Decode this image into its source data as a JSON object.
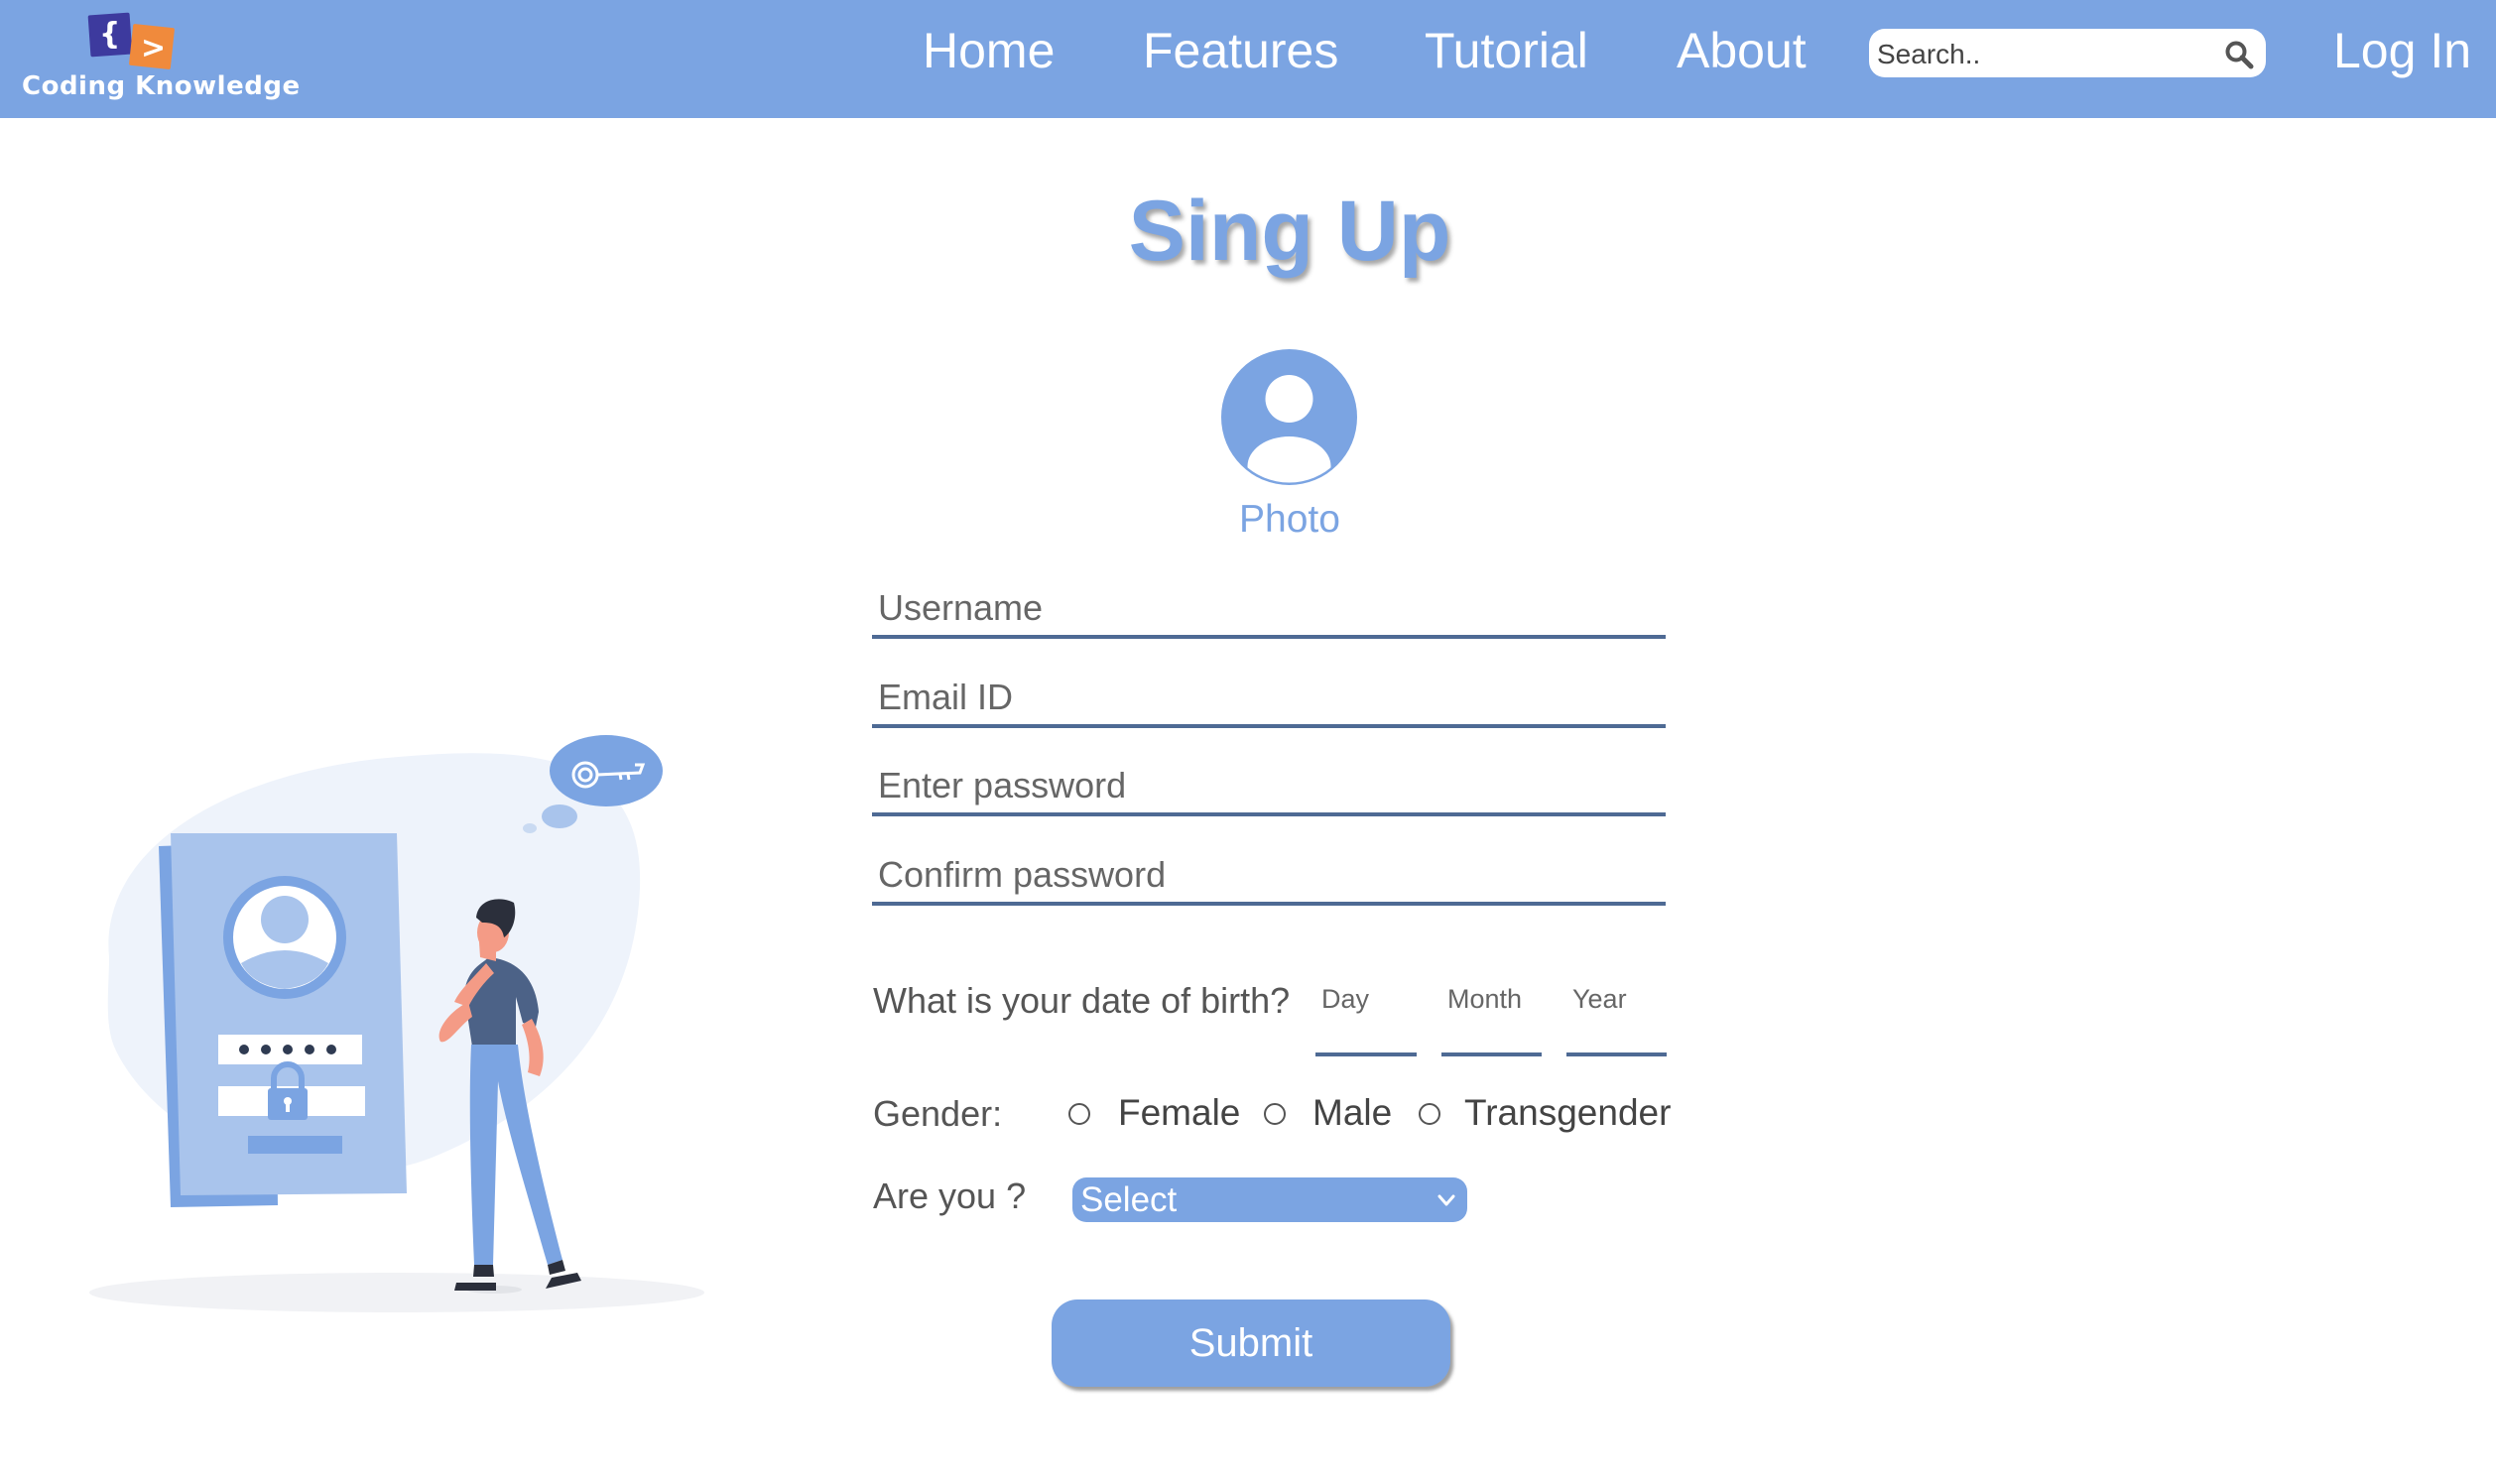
{
  "header": {
    "logo_text": "Coding Knowledge",
    "nav": [
      {
        "label": "Home"
      },
      {
        "label": "Features"
      },
      {
        "label": "Tutorial"
      },
      {
        "label": "About"
      }
    ],
    "search": {
      "placeholder": "Search..",
      "value": ""
    },
    "login_label": "Log In"
  },
  "page": {
    "title": "Sing Up",
    "photo_label": "Photo"
  },
  "form": {
    "username_placeholder": "Username",
    "email_placeholder": "Email ID",
    "password_placeholder": "Enter password",
    "confirm_placeholder": "Confirm password",
    "dob_question": "What is your date of birth?",
    "dob_day_placeholder": "Day",
    "dob_month_placeholder": "Month",
    "dob_year_placeholder": "Year",
    "gender_label": "Gender:",
    "gender_options": [
      "Female",
      "Male",
      "Transgender"
    ],
    "are_you_label": "Are you ?",
    "select_value": "Select",
    "submit_label": "Submit"
  },
  "colors": {
    "primary": "#7ba4e2",
    "underline": "#4e6a94",
    "logo_orange": "#f08a3c",
    "logo_indigo": "#3d3a9e",
    "illustration_dark": "#3d5a80"
  },
  "icons": [
    "logo-icon",
    "search-icon",
    "user-avatar-icon",
    "chevron-down-icon",
    "lock-icon",
    "key-icon"
  ]
}
